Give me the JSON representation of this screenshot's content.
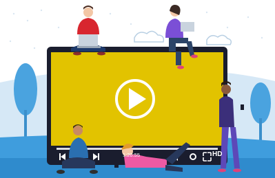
{
  "player": {
    "time": "1:20:55",
    "quality": "HD"
  },
  "colors": {
    "screen": "#e2c300",
    "frame": "#1a1d2e",
    "background_blue": "#cfe3f4",
    "accent_blue": "#4aa3df"
  },
  "icons": [
    "play-icon",
    "previous-icon",
    "next-icon",
    "volume-icon",
    "settings-icon",
    "fullscreen-icon"
  ]
}
